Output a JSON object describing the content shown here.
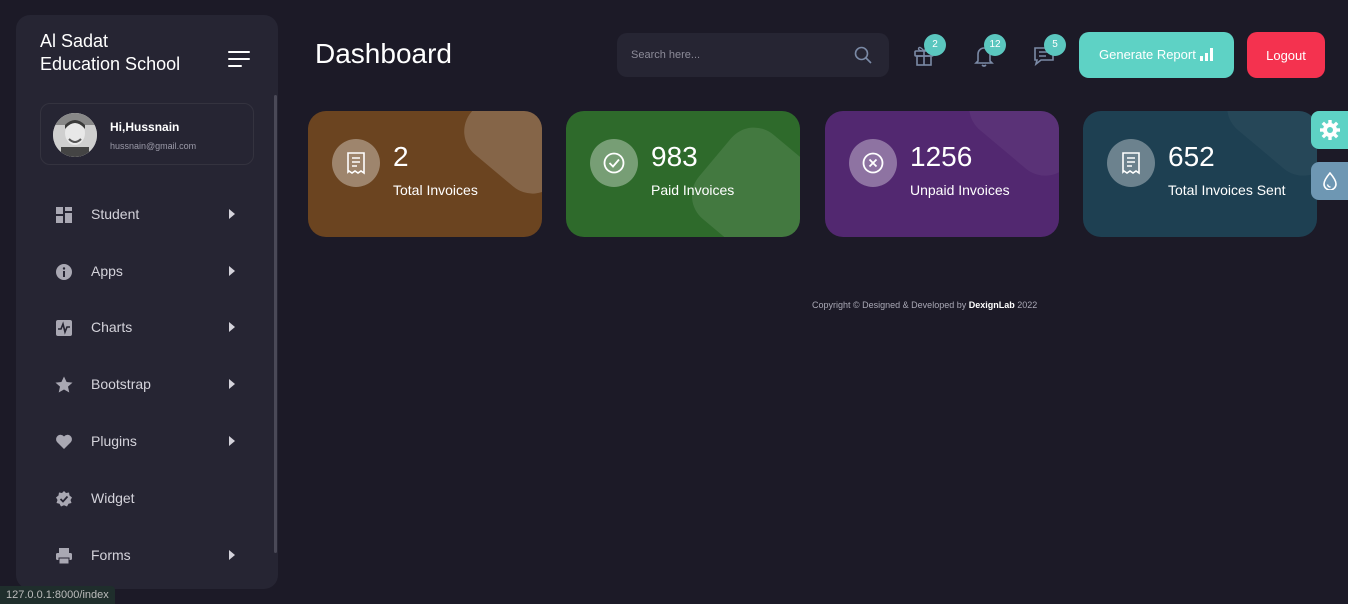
{
  "sidebar": {
    "brand_line1": "Al Sadat",
    "brand_line2": "Education School",
    "user": {
      "greeting": "Hi,",
      "name": "Hussnain",
      "email": "hussnain@gmail.com"
    },
    "items": [
      {
        "label": "Student",
        "icon": "grid-icon",
        "has_arrow": true
      },
      {
        "label": "Apps",
        "icon": "info-icon",
        "has_arrow": true
      },
      {
        "label": "Charts",
        "icon": "pulse-chart-icon",
        "has_arrow": true
      },
      {
        "label": "Bootstrap",
        "icon": "star-icon",
        "has_arrow": true
      },
      {
        "label": "Plugins",
        "icon": "heart-icon",
        "has_arrow": true
      },
      {
        "label": "Widget",
        "icon": "badge-check-icon",
        "has_arrow": false
      },
      {
        "label": "Forms",
        "icon": "printer-icon",
        "has_arrow": true
      }
    ]
  },
  "header": {
    "title": "Dashboard",
    "search_placeholder": "Search here...",
    "badges": {
      "gift": "2",
      "bell": "12",
      "chat": "5"
    },
    "report_label": "Generate Report",
    "logout_label": "Logout"
  },
  "cards": [
    {
      "value": "2",
      "label": "Total Invoices",
      "icon": "receipt-icon",
      "color": "#6b4420"
    },
    {
      "value": "983",
      "label": "Paid Invoices",
      "icon": "check-circle-icon",
      "color": "#2e6a2b"
    },
    {
      "value": "1256",
      "label": "Unpaid Invoices",
      "icon": "x-circle-icon",
      "color": "#522870"
    },
    {
      "value": "652",
      "label": "Total Invoices Sent",
      "icon": "receipt-icon",
      "color": "#1e4052"
    }
  ],
  "footer": {
    "prefix": "Copyright © Designed & Developed by ",
    "brand": "DexignLab",
    "year": " 2022"
  },
  "status_url": "127.0.0.1:8000/index",
  "colors": {
    "bg": "#1c1a27",
    "panel": "#262533",
    "accent": "#5ed2c5",
    "danger": "#f4324f"
  }
}
